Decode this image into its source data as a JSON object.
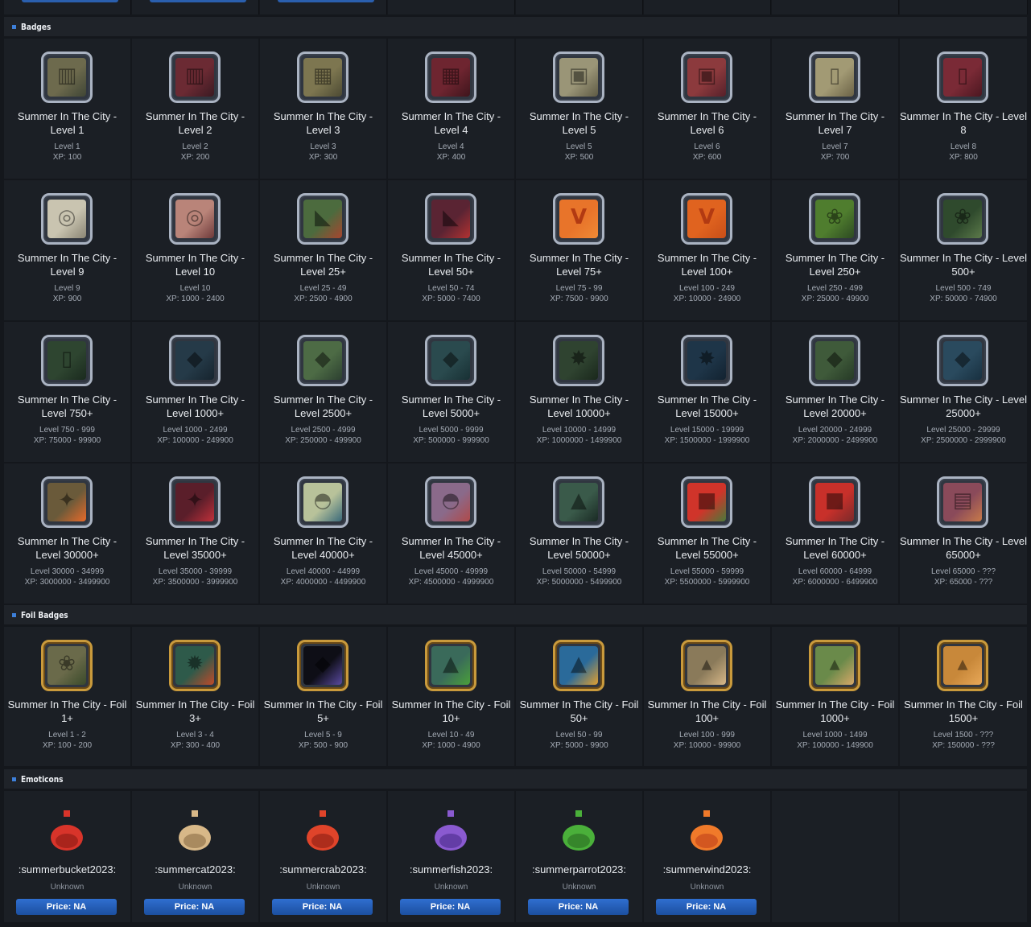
{
  "sections": {
    "badges": "Badges",
    "foil": "Foil Badges",
    "emoticons": "Emoticons"
  },
  "badges": [
    {
      "name": "Summer In The City - Level 1",
      "range": "Level 1",
      "xp": "XP: 100",
      "color": "#6d6a4d",
      "color2": "#3f4535",
      "icon": "cabinet"
    },
    {
      "name": "Summer In The City - Level 2",
      "range": "Level 2",
      "xp": "XP: 200",
      "color": "#6b2a33",
      "color2": "#3a1a22",
      "icon": "cabinet"
    },
    {
      "name": "Summer In The City - Level 3",
      "range": "Level 3",
      "xp": "XP: 300",
      "color": "#7d7650",
      "color2": "#4c4a33",
      "icon": "grid"
    },
    {
      "name": "Summer In The City - Level 4",
      "range": "Level 4",
      "xp": "XP: 400",
      "color": "#6e2530",
      "color2": "#3e151c",
      "icon": "grid"
    },
    {
      "name": "Summer In The City - Level 5",
      "range": "Level 5",
      "xp": "XP: 500",
      "color": "#9a9577",
      "color2": "#5e5a44",
      "icon": "box"
    },
    {
      "name": "Summer In The City - Level 6",
      "range": "Level 6",
      "xp": "XP: 600",
      "color": "#8c3a3d",
      "color2": "#55202a",
      "icon": "box"
    },
    {
      "name": "Summer In The City - Level 7",
      "range": "Level 7",
      "xp": "XP: 700",
      "color": "#a29a74",
      "color2": "#6b6246",
      "icon": "pipe"
    },
    {
      "name": "Summer In The City - Level 8",
      "range": "Level 8",
      "xp": "XP: 800",
      "color": "#7a2a36",
      "color2": "#4b1720",
      "icon": "pipe"
    },
    {
      "name": "Summer In The City - Level 9",
      "range": "Level 9",
      "xp": "XP: 900",
      "color": "#c9c4b0",
      "color2": "#8a8574",
      "icon": "fan"
    },
    {
      "name": "Summer In The City - Level 10",
      "range": "Level 10",
      "xp": "XP: 1000 - 2400",
      "color": "#b98479",
      "color2": "#6e3a3a",
      "icon": "fan"
    },
    {
      "name": "Summer In The City - Level 25+",
      "range": "Level 25 - 49",
      "xp": "XP: 2500 - 4900",
      "color": "#4c6b3e",
      "color2": "#a8452f",
      "icon": "flag"
    },
    {
      "name": "Summer In The City - Level 50+",
      "range": "Level 50 - 74",
      "xp": "XP: 5000 - 7400",
      "color": "#5a2433",
      "color2": "#b23232",
      "icon": "flag"
    },
    {
      "name": "Summer In The City - Level 75+",
      "range": "Level 75 - 99",
      "xp": "XP: 7500 - 9900",
      "color": "#e8742a",
      "color2": "#f08a35",
      "icon": "V"
    },
    {
      "name": "Summer In The City - Level 100+",
      "range": "Level 100 - 249",
      "xp": "XP: 10000 - 24900",
      "color": "#e0631f",
      "color2": "#c84e18",
      "icon": "V"
    },
    {
      "name": "Summer In The City - Level 250+",
      "range": "Level 250 - 499",
      "xp": "XP: 25000 - 49900",
      "color": "#4f7d2e",
      "color2": "#2d4a22",
      "icon": "leaf"
    },
    {
      "name": "Summer In The City - Level 500+",
      "range": "Level 500 - 749",
      "xp": "XP: 50000 - 74900",
      "color": "#2f4a2d",
      "color2": "#5c7a4a",
      "icon": "leaf"
    },
    {
      "name": "Summer In The City - Level 750+",
      "range": "Level 750 - 999",
      "xp": "XP: 75000 - 99900",
      "color": "#2e4530",
      "color2": "#1a2a1e",
      "icon": "pipe"
    },
    {
      "name": "Summer In The City - Level 1000+",
      "range": "Level 1000 - 2499",
      "xp": "XP: 100000 - 249900",
      "color": "#253a48",
      "color2": "#16242e",
      "icon": "fish"
    },
    {
      "name": "Summer In The City - Level 2500+",
      "range": "Level 2500 - 4999",
      "xp": "XP: 250000 - 499900",
      "color": "#4d6b45",
      "color2": "#2c4030",
      "icon": "fish"
    },
    {
      "name": "Summer In The City - Level 5000+",
      "range": "Level 5000 - 9999",
      "xp": "XP: 500000 - 999900",
      "color": "#2a4a4e",
      "color2": "#183034",
      "icon": "fish"
    },
    {
      "name": "Summer In The City - Level 10000+",
      "range": "Level 10000 - 14999",
      "xp": "XP: 1000000 - 1499900",
      "color": "#2f4330",
      "color2": "#1a281c",
      "icon": "wheel"
    },
    {
      "name": "Summer In The City - Level 15000+",
      "range": "Level 15000 - 19999",
      "xp": "XP: 1500000 - 1999900",
      "color": "#1e3548",
      "color2": "#122230",
      "icon": "wheel"
    },
    {
      "name": "Summer In The City - Level 20000+",
      "range": "Level 20000 - 24999",
      "xp": "XP: 2000000 - 2499900",
      "color": "#3f5a3a",
      "color2": "#263a26",
      "icon": "fish"
    },
    {
      "name": "Summer In The City - Level 25000+",
      "range": "Level 25000 - 29999",
      "xp": "XP: 2500000 - 2999900",
      "color": "#2a4a5e",
      "color2": "#183040",
      "icon": "fish"
    },
    {
      "name": "Summer In The City - Level 30000+",
      "range": "Level 30000 - 34999",
      "xp": "XP: 3000000 - 3499900",
      "color": "#6a5a3a",
      "color2": "#e86a2a",
      "icon": "wind"
    },
    {
      "name": "Summer In The City - Level 35000+",
      "range": "Level 35000 - 39999",
      "xp": "XP: 3500000 - 3999900",
      "color": "#5a1e2a",
      "color2": "#c0303a",
      "icon": "wind"
    },
    {
      "name": "Summer In The City - Level 40000+",
      "range": "Level 40000 - 44999",
      "xp": "XP: 4000000 - 4499900",
      "color": "#b8c29a",
      "color2": "#3a6a7a",
      "icon": "umbrella"
    },
    {
      "name": "Summer In The City - Level 45000+",
      "range": "Level 45000 - 49999",
      "xp": "XP: 4500000 - 4999900",
      "color": "#8a6a8a",
      "color2": "#b04a4a",
      "icon": "umbrella"
    },
    {
      "name": "Summer In The City - Level 50000+",
      "range": "Level 50000 - 54999",
      "xp": "XP: 5000000 - 5499900",
      "color": "#3a5a4a",
      "color2": "#1a2a24",
      "icon": "parrot"
    },
    {
      "name": "Summer In The City - Level 55000+",
      "range": "Level 55000 - 59999",
      "xp": "XP: 5500000 - 5999900",
      "color": "#d0342a",
      "color2": "#4a7a3a",
      "icon": "bucket"
    },
    {
      "name": "Summer In The City - Level 60000+",
      "range": "Level 60000 - 64999",
      "xp": "XP: 6000000 - 6499900",
      "color": "#c8302a",
      "color2": "#7a2a2a",
      "icon": "bucket"
    },
    {
      "name": "Summer In The City - Level 65000+",
      "range": "Level 65000 - ???",
      "xp": "XP: 65000 - ???",
      "color": "#8a4a5a",
      "color2": "#c87a4a",
      "icon": "chair"
    }
  ],
  "foil_badges": [
    {
      "name": "Summer In The City - Foil 1+",
      "range": "Level 1 - 2",
      "xp": "XP: 100 - 200",
      "color": "#6a6a4a",
      "color2": "#3a4a2a",
      "icon": "leaf"
    },
    {
      "name": "Summer In The City - Foil 3+",
      "range": "Level 3 - 4",
      "xp": "XP: 300 - 400",
      "color": "#2e5a4a",
      "color2": "#c04a2a",
      "icon": "crab"
    },
    {
      "name": "Summer In The City - Foil 5+",
      "range": "Level 5 - 9",
      "xp": "XP: 500 - 900",
      "color": "#0e0e16",
      "color2": "#5a4aa0",
      "icon": "fish"
    },
    {
      "name": "Summer In The City - Foil 10+",
      "range": "Level 10 - 49",
      "xp": "XP: 1000 - 4900",
      "color": "#3a6a5a",
      "color2": "#4aa03a",
      "icon": "parrot"
    },
    {
      "name": "Summer In The City - Foil 50+",
      "range": "Level 50 - 99",
      "xp": "XP: 5000 - 9900",
      "color": "#2a6a9a",
      "color2": "#e0a030",
      "icon": "parrot"
    },
    {
      "name": "Summer In The City - Foil 100+",
      "range": "Level 100 - 999",
      "xp": "XP: 10000 - 99900",
      "color": "#8a7a5a",
      "color2": "#d8b888",
      "icon": "cat"
    },
    {
      "name": "Summer In The City - Foil 1000+",
      "range": "Level 1000 - 1499",
      "xp": "XP: 100000 - 149900",
      "color": "#6a8a4a",
      "color2": "#d8a868",
      "icon": "cat"
    },
    {
      "name": "Summer In The City - Foil 1500+",
      "range": "Level 1500 - ???",
      "xp": "XP: 150000 - ???",
      "color": "#c8883a",
      "color2": "#e8a858",
      "icon": "cat"
    }
  ],
  "emoticons": [
    {
      "name": ":summerbucket2023:",
      "status": "Unknown",
      "price": "Price: NA",
      "icon": "bucket"
    },
    {
      "name": ":summercat2023:",
      "status": "Unknown",
      "price": "Price: NA",
      "icon": "cat"
    },
    {
      "name": ":summercrab2023:",
      "status": "Unknown",
      "price": "Price: NA",
      "icon": "crab"
    },
    {
      "name": ":summerfish2023:",
      "status": "Unknown",
      "price": "Price: NA",
      "icon": "fish"
    },
    {
      "name": ":summerparrot2023:",
      "status": "Unknown",
      "price": "Price: NA",
      "icon": "parrot"
    },
    {
      "name": ":summerwind2023:",
      "status": "Unknown",
      "price": "Price: NA",
      "icon": "wind"
    }
  ]
}
